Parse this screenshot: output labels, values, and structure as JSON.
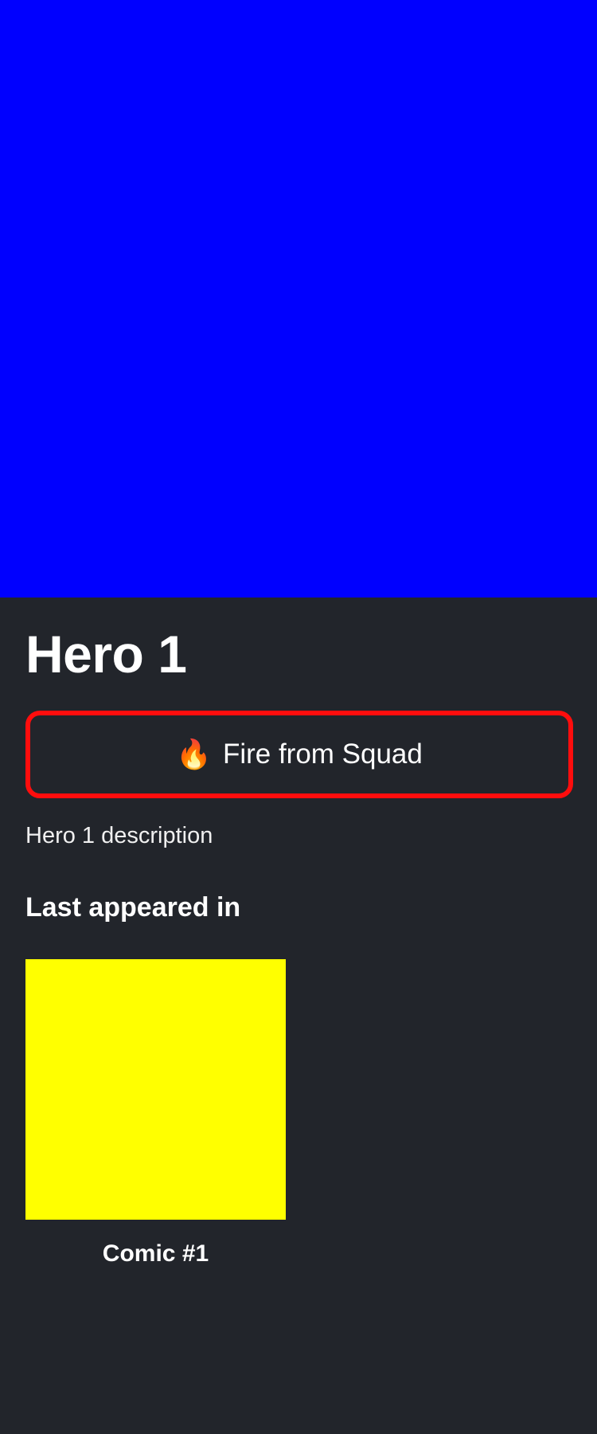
{
  "hero": {
    "image_color": "#0000ff",
    "name": "Hero 1",
    "description": "Hero 1 description"
  },
  "squad_button": {
    "icon": "fire-icon",
    "icon_glyph": "🔥",
    "label": "Fire from Squad",
    "border_color": "#ff0d0d"
  },
  "appearances": {
    "section_title": "Last appeared in",
    "comics": [
      {
        "title": "Comic #1",
        "thumb_color": "#ffff00"
      }
    ]
  },
  "colors": {
    "background": "#22252b",
    "text": "#ffffff"
  }
}
